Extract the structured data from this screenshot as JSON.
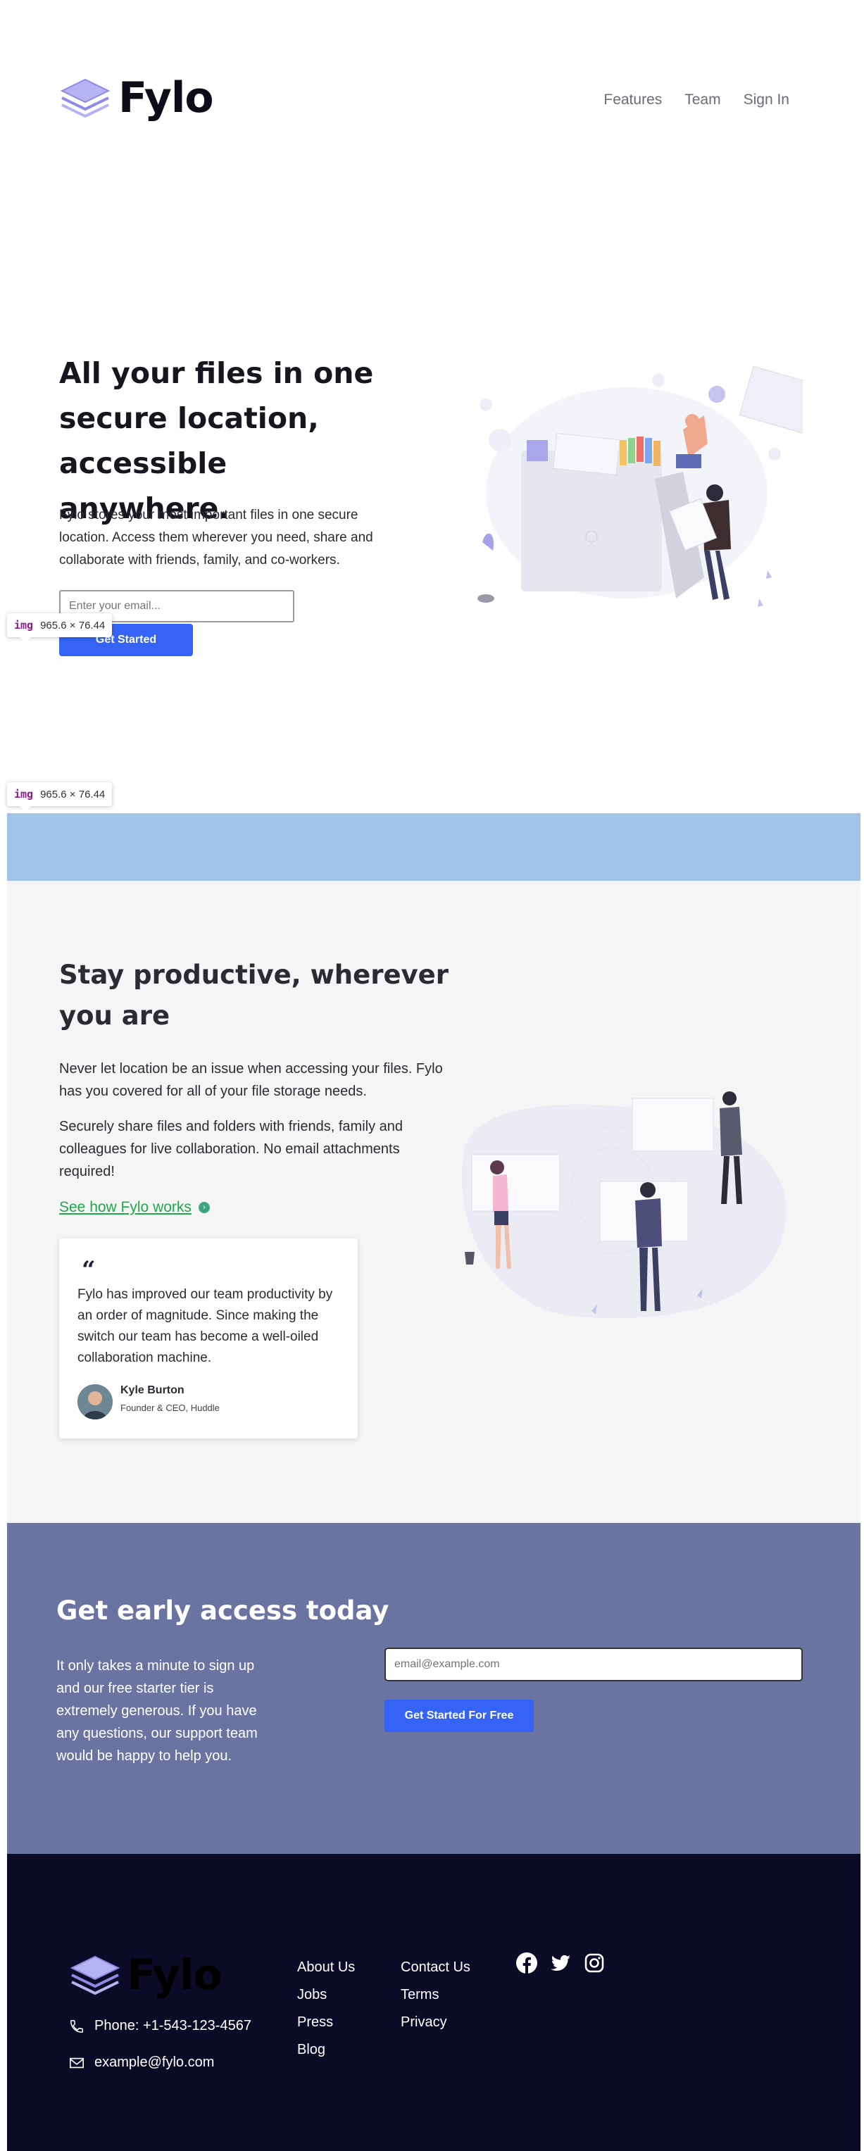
{
  "brand": {
    "name": "Fylo"
  },
  "nav": {
    "items": [
      "Features",
      "Team",
      "Sign In"
    ]
  },
  "hero": {
    "title": "All your files in one secure location, accessible anywhere.",
    "text": "Fylo stores your most important files in one secure location. Access them wherever you need, share and collaborate with friends, family, and co-workers.",
    "email_placeholder": "Enter your email...",
    "button": "Get Started"
  },
  "tooltips": [
    {
      "tag": "img",
      "size": "965.6 × 76.44"
    },
    {
      "tag": "img",
      "size": "965.6 × 76.44"
    }
  ],
  "productive": {
    "title": "Stay productive, wherever you are",
    "p1": "Never let location be an issue when accessing your files. Fylo has you covered for all of your file storage needs.",
    "p2": "Securely share files and folders with friends, family and colleagues for live collaboration. No email attachments required!",
    "link": "See how Fylo works",
    "testimonial": {
      "quote": "Fylo has improved our team productivity by an order of magnitude. Since making the switch our team has become a well-oiled collaboration machine.",
      "name": "Kyle Burton",
      "role": "Founder & CEO, Huddle"
    }
  },
  "cta": {
    "title": "Get early access today",
    "text": "It only takes a minute to sign up and our free starter tier is extremely generous. If you have any questions, our support team would be happy to help you.",
    "email_placeholder": "email@example.com",
    "button": "Get Started For Free"
  },
  "footer": {
    "phone": "Phone: +1-543-123-4567",
    "email": "example@fylo.com",
    "links_col1": [
      "About Us",
      "Jobs",
      "Press",
      "Blog"
    ],
    "links_col2": [
      "Contact Us",
      "Terms",
      "Privacy"
    ],
    "social": [
      "facebook-icon",
      "twitter-icon",
      "instagram-icon"
    ]
  },
  "colors": {
    "accent": "#3563f5",
    "link_green": "#1fa84a",
    "cta_bg": "#6b73a1",
    "footer_bg": "#0c0b27",
    "band": "#a2c4e8"
  }
}
